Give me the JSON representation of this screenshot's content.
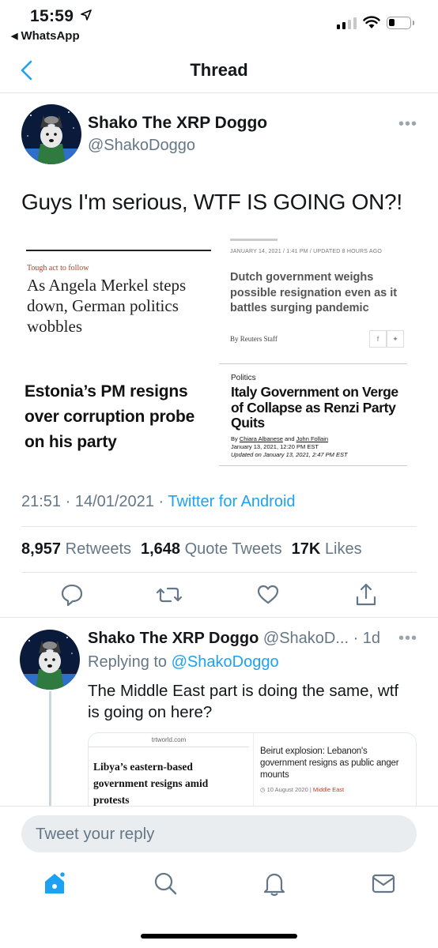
{
  "status_bar": {
    "time": "15:59",
    "back_app": "WhatsApp"
  },
  "nav": {
    "title": "Thread"
  },
  "tweet": {
    "author_name": "Shako The XRP Doggo",
    "author_handle": "@ShakoDoggo",
    "text": "Guys I'm serious, WTF IS GOING ON?!",
    "media": {
      "article1": {
        "kicker": "Tough act to follow",
        "headline": "As Angela Merkel steps down, German politics wobbles"
      },
      "article2": {
        "meta": "JANUARY 14, 2021 / 1:41 PM / UPDATED 8 HOURS AGO",
        "headline": "Dutch government weighs possible resignation even as it battles surging pandemic",
        "byline": "By Reuters Staff"
      },
      "article3": {
        "headline": "Estonia’s PM resigns over corruption probe on his party"
      },
      "article4": {
        "tag": "Politics",
        "headline": "Italy Government on Verge of Collapse as Renzi Party Quits",
        "byline_prefix": "By",
        "author1": "Chiara Albanese",
        "and": "and",
        "author2": "John Follain",
        "date": "January 13, 2021, 12:20 PM EST",
        "updated": "Updated on January 13, 2021, 2:47 PM EST"
      }
    },
    "time": "21:51 · 14/01/2021 · ",
    "source": "Twitter for Android",
    "retweets_count": "8,957",
    "retweets_label": "Retweets",
    "quotes_count": "1,648",
    "quotes_label": "Quote Tweets",
    "likes_count": "17K",
    "likes_label": "Likes"
  },
  "reply": {
    "author_name": "Shako The XRP Doggo",
    "handle_time": "@ShakoD... · 1d",
    "replying_prefix": "Replying to ",
    "replying_to": "@ShakoDoggo",
    "text": "The Middle East part is doing the same, wtf is going on here?",
    "media": {
      "left": {
        "url": "trtworld.com",
        "headline": "Libya’s eastern-based government resigns amid protests"
      },
      "right": {
        "headline": "Beirut explosion: Lebanon's government resigns as public anger mounts",
        "date": "10 August 2020",
        "category": "Middle East"
      }
    }
  },
  "composer": {
    "placeholder": "Tweet your reply"
  },
  "colors": {
    "accent": "#1da1f2",
    "muted": "#657786",
    "text": "#14171a"
  },
  "icons": [
    "location-arrow-icon",
    "signal-icon",
    "wifi-icon",
    "battery-icon",
    "back-chevron-icon",
    "more-icon",
    "reply-icon",
    "retweet-icon",
    "like-icon",
    "share-icon",
    "home-icon",
    "search-icon",
    "notifications-icon",
    "messages-icon"
  ]
}
